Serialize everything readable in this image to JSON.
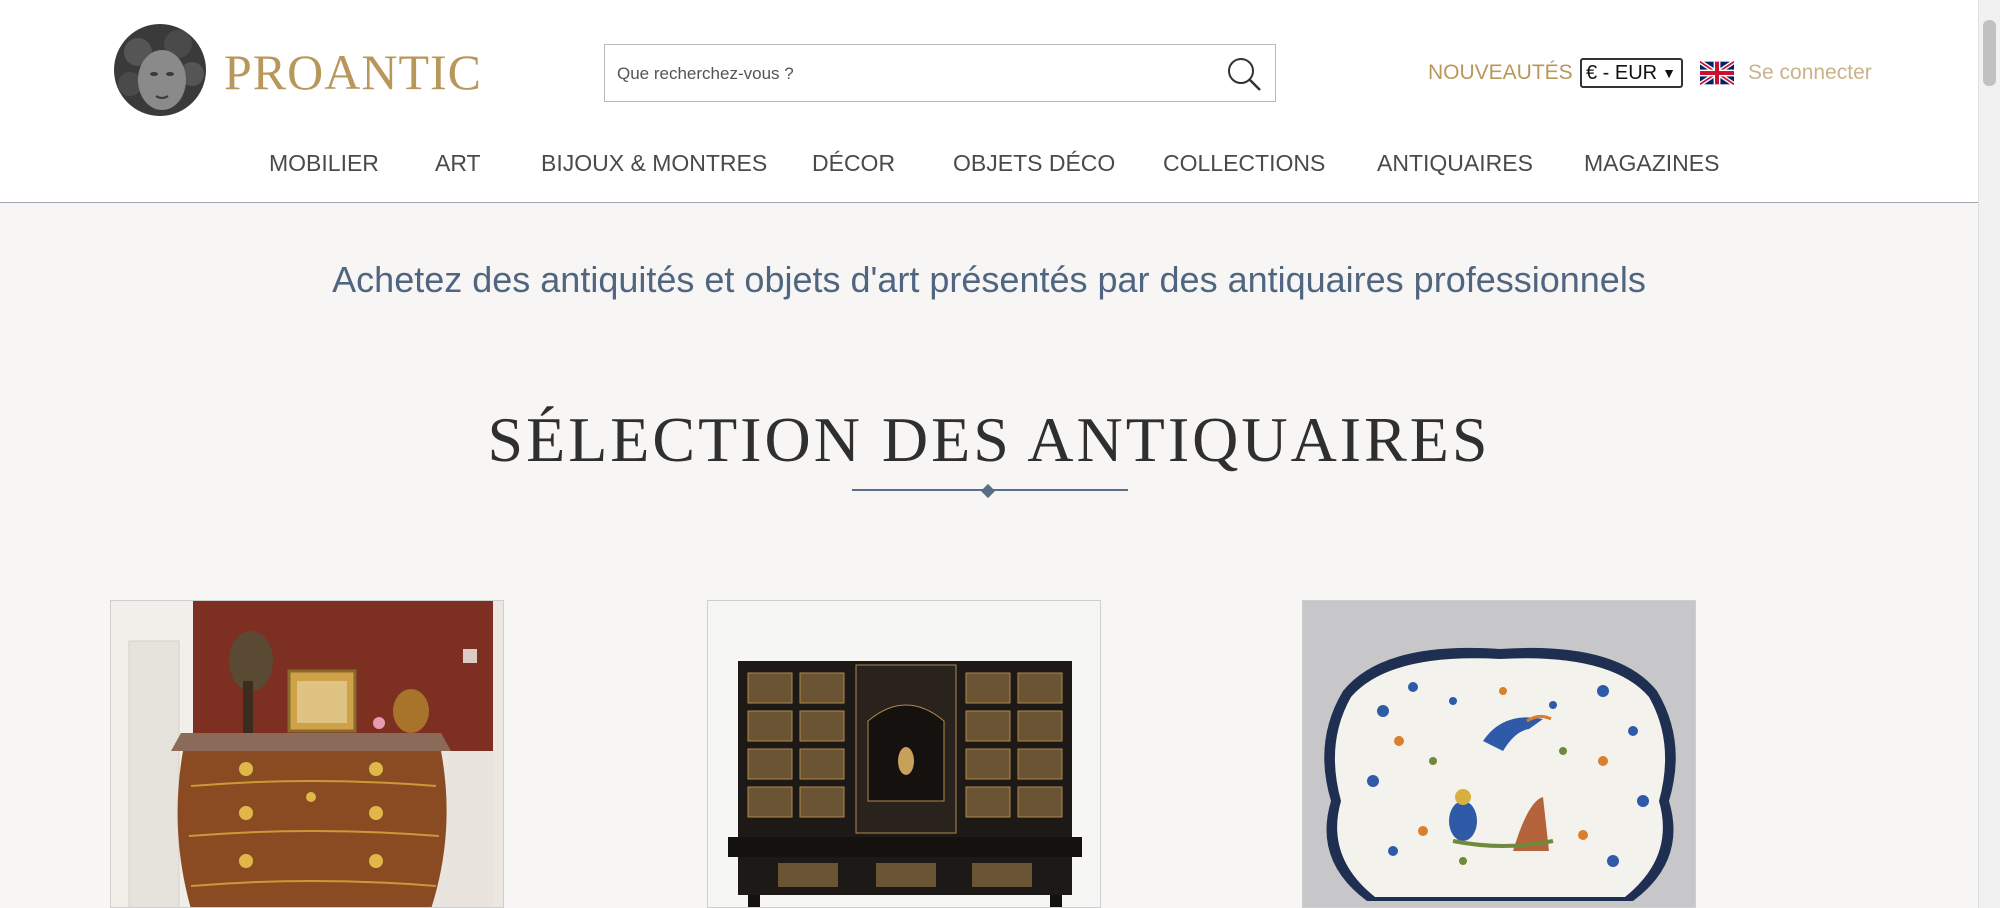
{
  "brand": {
    "name": "PROANTIC",
    "logo_icon": "sculpture-head-icon",
    "accent": "#b8985a"
  },
  "search": {
    "placeholder": "Que recherchez-vous ?",
    "icon": "search-icon"
  },
  "top_links": {
    "new": "NOUVEAUTÉS",
    "currency": "€ - EUR",
    "language_icon": "uk-flag-icon",
    "login": "Se connecter"
  },
  "nav": {
    "items": [
      "MOBILIER",
      "ART",
      "BIJOUX & MONTRES",
      "DÉCOR",
      "OBJETS DÉCO",
      "COLLECTIONS",
      "ANTIQUAIRES",
      "MAGAZINES"
    ]
  },
  "tagline": "Achetez des antiquités et objets d'art présentés par des antiquaires professionnels",
  "section": {
    "title": "SÉLECTION DES ANTIQUAIRES"
  },
  "cards": [
    {
      "image": "commode-with-gilt-mounts"
    },
    {
      "image": "ebony-cabinet-on-stand"
    },
    {
      "image": "faience-platter-with-birds"
    }
  ]
}
